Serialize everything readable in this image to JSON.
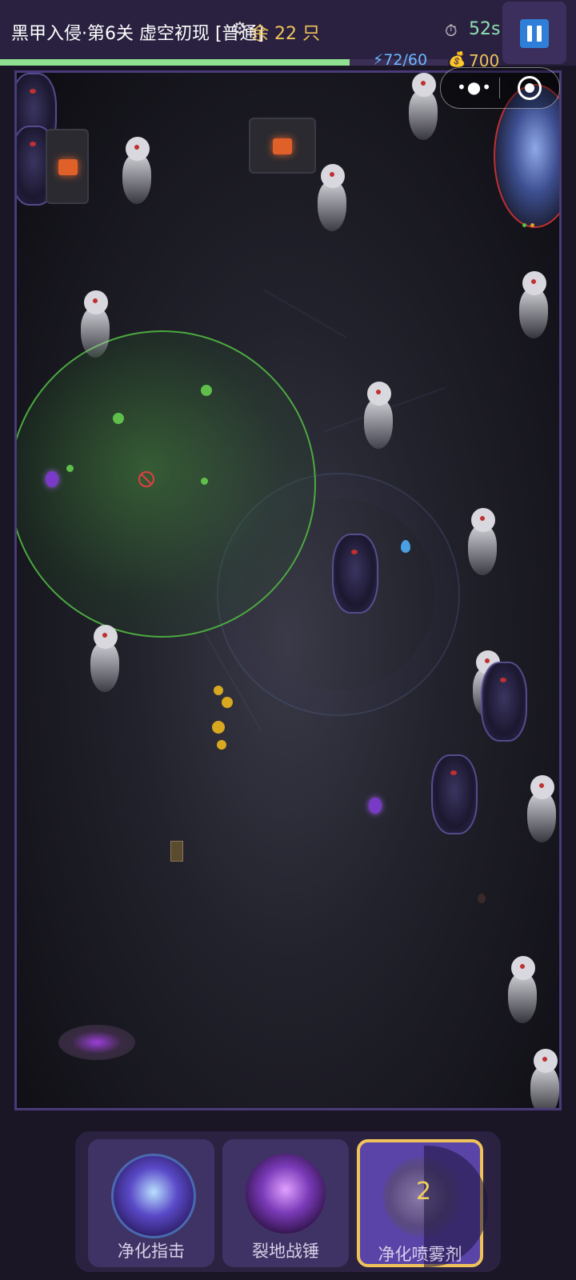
{
  "hud": {
    "title": "黑甲入侵·第6关 虚空初现 [普通]",
    "remaining": "余 22 只",
    "timer": "52s",
    "energy": "72/60",
    "gold": "700",
    "energy_fill": 0.78
  },
  "skills": [
    {
      "label": "净化指击",
      "icon": "purify-finger-icon"
    },
    {
      "label": "裂地战锤",
      "icon": "war-hammer-icon"
    },
    {
      "label": "净化喷雾剂",
      "icon": "spray-lantern-icon",
      "count": "2",
      "selected": true
    }
  ],
  "colors": {
    "accent_gold": "#f0c35a",
    "energy_blue": "#6cb8ff",
    "range_green": "#4caa40",
    "panel": "#2a2240"
  }
}
